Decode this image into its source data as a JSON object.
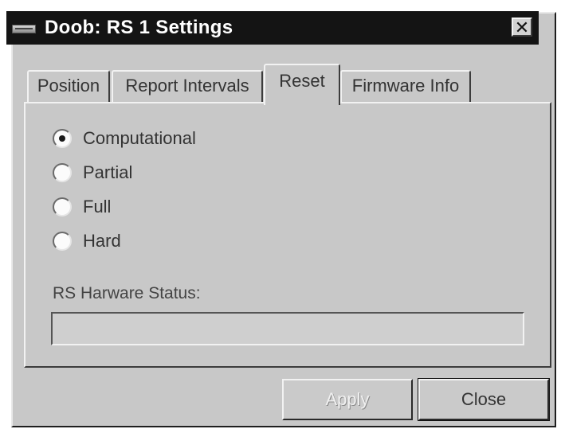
{
  "window": {
    "title": "Doob: RS 1 Settings",
    "close_glyph": "✕"
  },
  "tabs": [
    {
      "label": "Position",
      "active": false
    },
    {
      "label": "Report Intervals",
      "active": false
    },
    {
      "label": "Reset",
      "active": true
    },
    {
      "label": "Firmware Info",
      "active": false
    }
  ],
  "reset": {
    "options": [
      {
        "label": "Computational",
        "selected": true
      },
      {
        "label": "Partial",
        "selected": false
      },
      {
        "label": "Full",
        "selected": false
      },
      {
        "label": "Hard",
        "selected": false
      }
    ],
    "status_label": "RS Harware Status:",
    "status_value": ""
  },
  "buttons": {
    "apply": "Apply",
    "apply_enabled": false,
    "close": "Close"
  }
}
